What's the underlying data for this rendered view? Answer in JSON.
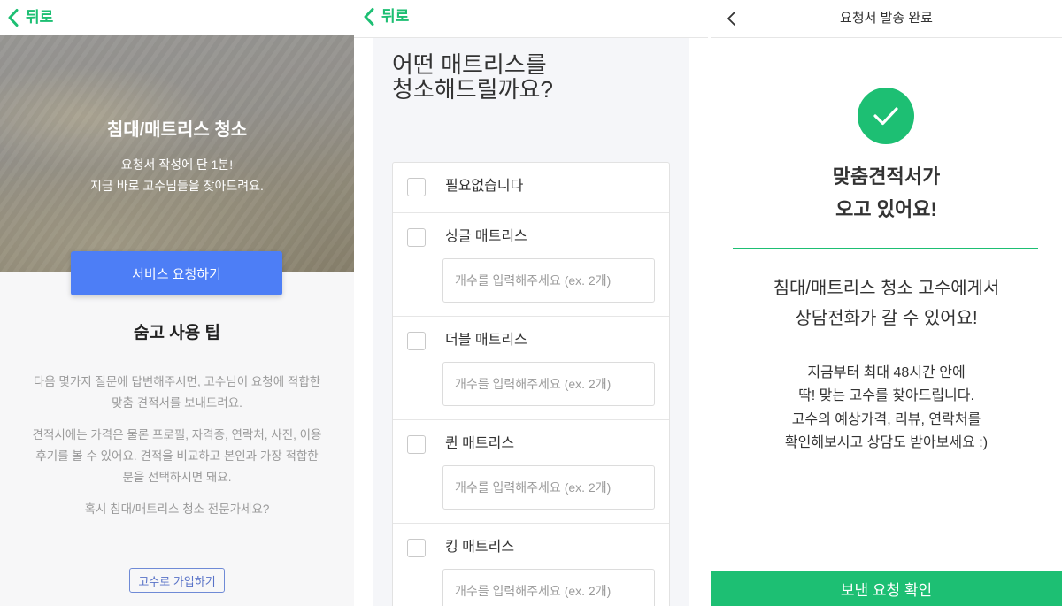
{
  "colors": {
    "accent_green": "#1dbf73",
    "primary_blue": "#4d7ef6",
    "outline_blue": "#6f8ad6"
  },
  "icons": {
    "back": "chevron-left-icon",
    "success": "check-circle-icon",
    "option": "checkbox-icon"
  },
  "intro": {
    "back_label": "뒤로",
    "hero_title": "침대/매트리스 청소",
    "hero_subtitle": "요청서 작성에 단 1분!\n지금 바로 고수님들을 찾아드려요.",
    "request_button": "서비스 요청하기",
    "tips_title": "숨고 사용 팁",
    "tips": [
      "다음 몇가지 질문에 답변해주시면, 고수님이 요청에 적합한\n맞춤 견적서를 보내드려요.",
      "견적서에는 가격은 물론 프로필, 자격증, 연락처, 사진, 이용\n후기를 볼 수 있어요. 견적을 비교하고 본인과 가장 적합한\n분을 선택하시면 돼요.",
      "혹시 침대/매트리스 청소 전문가세요?"
    ],
    "pro_signup_button": "고수로 가입하기"
  },
  "question": {
    "back_label": "뒤로",
    "title": "어떤 매트리스를\n청소해드릴까요?",
    "options": [
      {
        "label": "필요없습니다",
        "checked": false
      },
      {
        "label": "싱글 매트리스",
        "checked": false,
        "quantity_value": "",
        "quantity_placeholder": "개수를 입력해주세요 (ex. 2개)"
      },
      {
        "label": "더블 매트리스",
        "checked": false,
        "quantity_value": "",
        "quantity_placeholder": "개수를 입력해주세요 (ex. 2개)"
      },
      {
        "label": "퀸 매트리스",
        "checked": false,
        "quantity_value": "",
        "quantity_placeholder": "개수를 입력해주세요 (ex. 2개)"
      },
      {
        "label": "킹 매트리스",
        "checked": false,
        "quantity_value": "",
        "quantity_placeholder": "개수를 입력해주세요 (ex. 2개)"
      }
    ]
  },
  "complete": {
    "header_title": "요청서 발송 완료",
    "headline": "맞춤견적서가\n오고 있어요!",
    "message": "침대/매트리스 청소 고수에게서\n상담전화가 갈 수 있어요!",
    "details": "지금부터 최대 48시간 안에\n딱! 맞는 고수를 찾아드립니다.\n고수의 예상가격, 리뷰, 연락처를\n확인해보시고 상담도 받아보세요 :)",
    "confirm_button": "보낸 요청 확인"
  }
}
